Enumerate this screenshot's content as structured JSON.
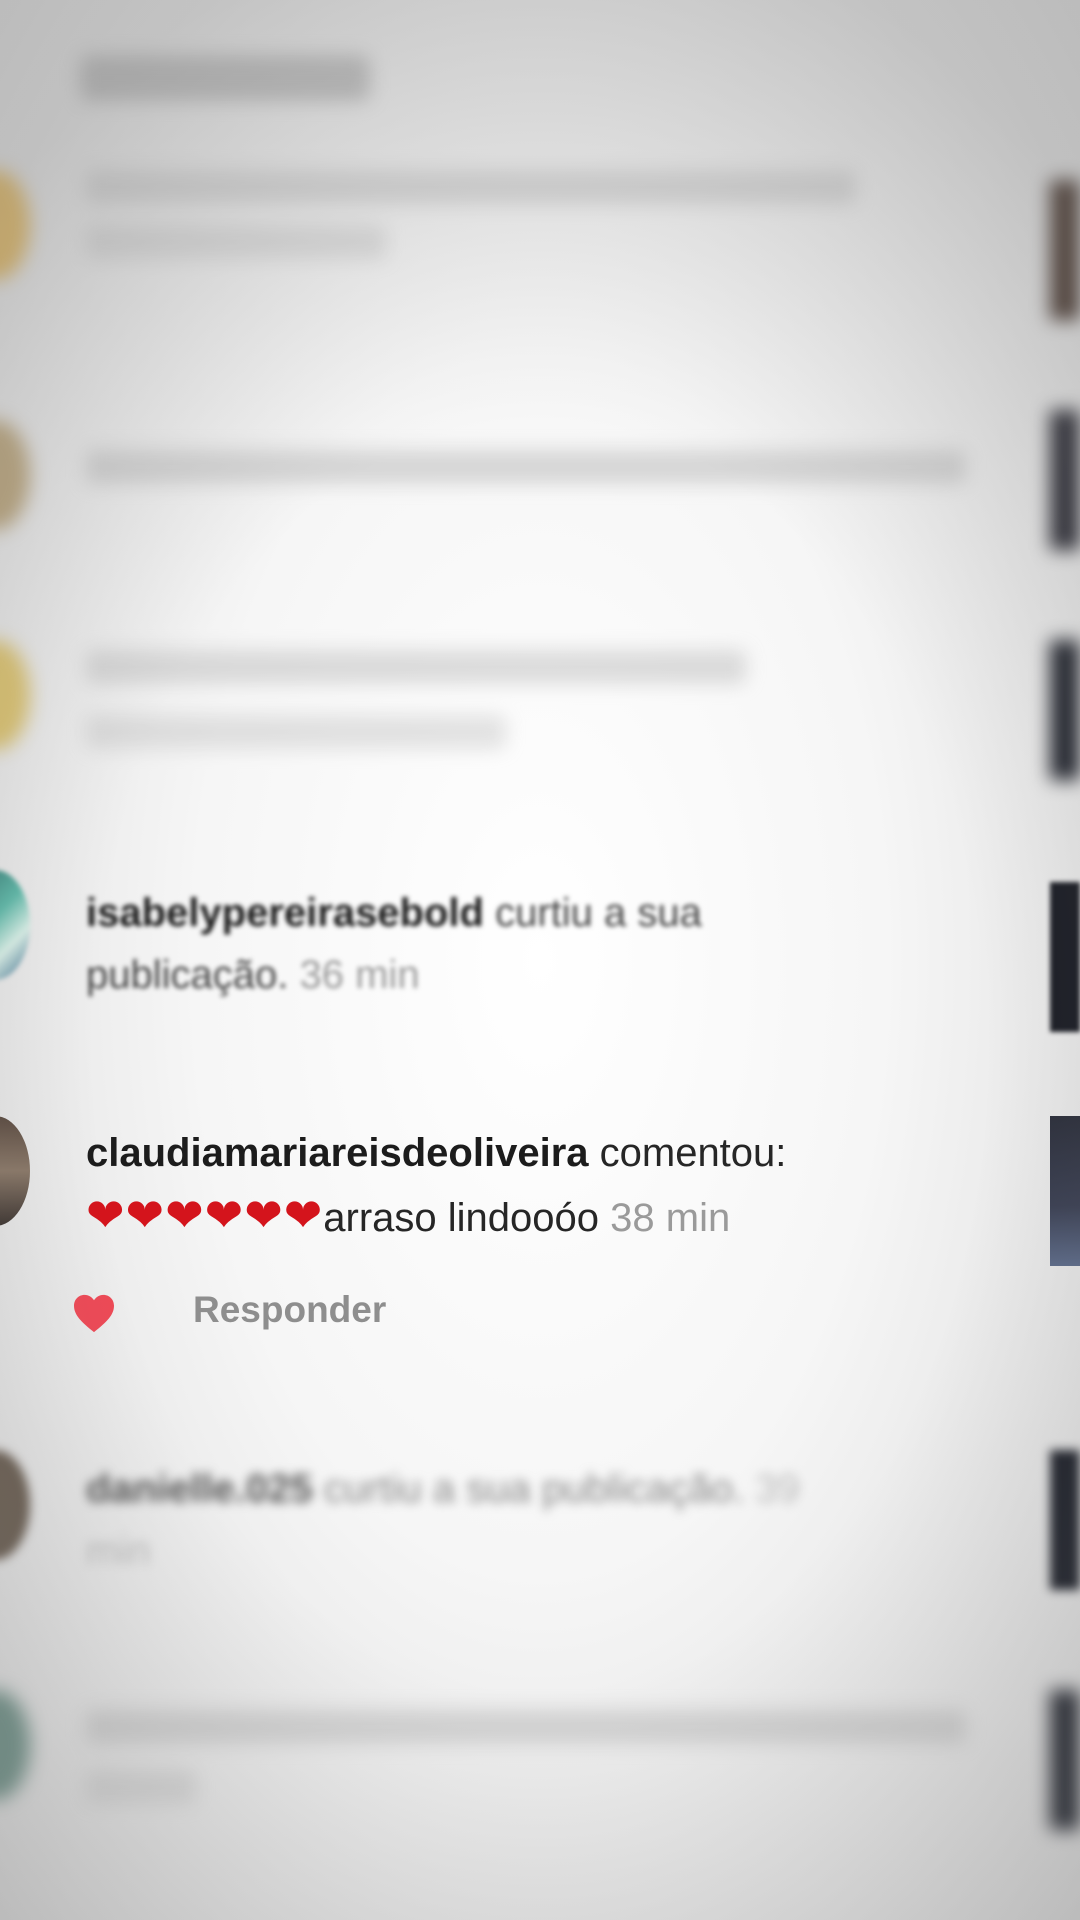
{
  "rows": [
    {
      "username": "isabelypereirasebold",
      "action": "curtiu a sua",
      "action_2": "publicação.",
      "time": "36 min"
    },
    {
      "username": "claudiamariareisdeoliveira",
      "action": "comentou:",
      "comment_text": "arraso lindooóo",
      "time": "38 min",
      "reply_label": "Responder"
    },
    {
      "username": "danielle.025",
      "action": "curtiu a sua publicação.",
      "time_a": "39",
      "time_b": "min"
    }
  ],
  "colors": {
    "heart": "#d4141c",
    "like_heart": "#ed4956",
    "secondary_text": "#8e8e8e"
  }
}
